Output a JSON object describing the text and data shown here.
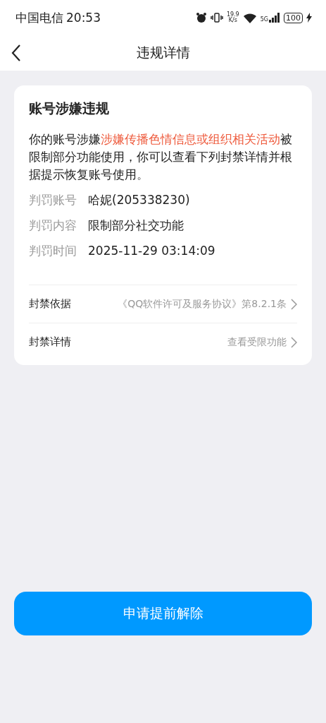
{
  "status_bar": {
    "carrier": "中国电信",
    "time": "20:53",
    "net_speed": "19.9",
    "net_speed_unit": "K/s",
    "network": "5G",
    "battery": "100"
  },
  "nav": {
    "title": "违规详情"
  },
  "card": {
    "title": "账号涉嫌违规",
    "description": [
      {
        "text": "你的账号涉嫌",
        "highlight": false
      },
      {
        "text": "涉嫌传播色情信息或组织相关活动",
        "highlight": true
      },
      {
        "text": "被限制部分功能使用，你可以查看下列封禁详情并根据提示恢复账号使用。",
        "highlight": false
      }
    ],
    "fields": [
      {
        "label": "判罚账号",
        "value": "哈妮(205338230)"
      },
      {
        "label": "判罚内容",
        "value": "限制部分社交功能"
      },
      {
        "label": "判罚时间",
        "value": "2025-11-29 03:14:09"
      }
    ],
    "links": [
      {
        "label": "封禁依据",
        "value": "《QQ软件许可及服务协议》第8.2.1条"
      },
      {
        "label": "封禁详情",
        "value": "查看受限功能"
      }
    ]
  },
  "action_button": "申请提前解除"
}
